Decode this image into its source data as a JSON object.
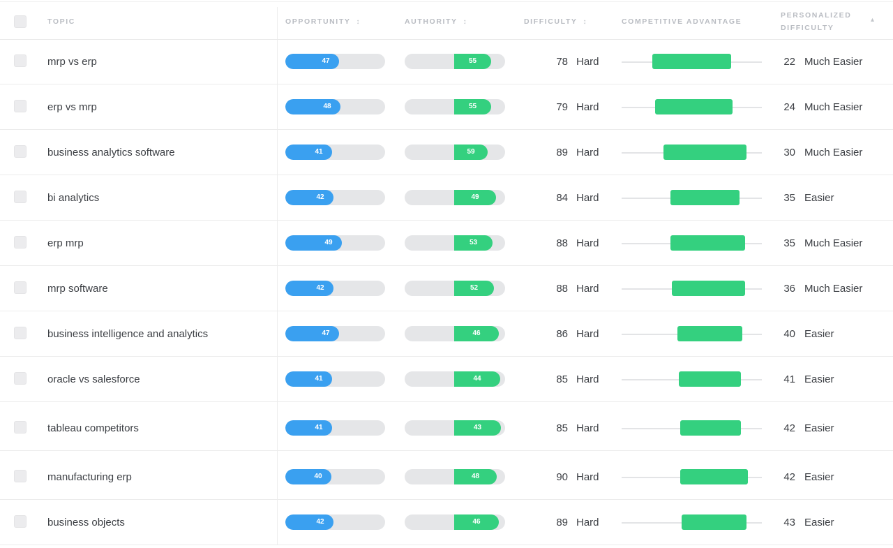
{
  "header": {
    "topic": "TOPIC",
    "opportunity": "OPPORTUNITY",
    "authority": "AUTHORITY",
    "difficulty": "DIFFICULTY",
    "competitive_advantage": "COMPETITIVE ADVANTAGE",
    "personalized_difficulty": "PERSONALIZED DIFFICULTY",
    "sort_glyph": "↕",
    "sort_active_glyph": "▴"
  },
  "colors": {
    "opportunity": "#3aa0f0",
    "authority": "#34d07f",
    "advantage": "#34d07f"
  },
  "rows": [
    {
      "topic": "mrp vs erp",
      "opportunity": "47",
      "authority": "55",
      "difficulty": "78",
      "difficulty_label": "Hard",
      "advantage": {
        "start": 0.22,
        "end": 0.78
      },
      "personalized": "22",
      "personalized_label": "Much Easier"
    },
    {
      "topic": "erp vs mrp",
      "opportunity": "48",
      "authority": "55",
      "difficulty": "79",
      "difficulty_label": "Hard",
      "advantage": {
        "start": 0.24,
        "end": 0.79
      },
      "personalized": "24",
      "personalized_label": "Much Easier"
    },
    {
      "topic": "business analytics software",
      "opportunity": "41",
      "authority": "59",
      "difficulty": "89",
      "difficulty_label": "Hard",
      "advantage": {
        "start": 0.3,
        "end": 0.89
      },
      "personalized": "30",
      "personalized_label": "Much Easier"
    },
    {
      "topic": "bi analytics",
      "opportunity": "42",
      "authority": "49",
      "difficulty": "84",
      "difficulty_label": "Hard",
      "advantage": {
        "start": 0.35,
        "end": 0.84
      },
      "personalized": "35",
      "personalized_label": "Easier"
    },
    {
      "topic": "erp mrp",
      "opportunity": "49",
      "authority": "53",
      "difficulty": "88",
      "difficulty_label": "Hard",
      "advantage": {
        "start": 0.35,
        "end": 0.88
      },
      "personalized": "35",
      "personalized_label": "Much Easier"
    },
    {
      "topic": "mrp software",
      "opportunity": "42",
      "authority": "52",
      "difficulty": "88",
      "difficulty_label": "Hard",
      "advantage": {
        "start": 0.36,
        "end": 0.88
      },
      "personalized": "36",
      "personalized_label": "Much Easier"
    },
    {
      "topic": "business intelligence and analytics",
      "opportunity": "47",
      "authority": "46",
      "difficulty": "86",
      "difficulty_label": "Hard",
      "advantage": {
        "start": 0.4,
        "end": 0.86
      },
      "personalized": "40",
      "personalized_label": "Easier"
    },
    {
      "topic": "oracle vs salesforce",
      "opportunity": "41",
      "authority": "44",
      "difficulty": "85",
      "difficulty_label": "Hard",
      "advantage": {
        "start": 0.41,
        "end": 0.85
      },
      "personalized": "41",
      "personalized_label": "Easier"
    },
    {
      "topic": "tableau competitors",
      "opportunity": "41",
      "authority": "43",
      "difficulty": "85",
      "difficulty_label": "Hard",
      "advantage": {
        "start": 0.42,
        "end": 0.85
      },
      "personalized": "42",
      "personalized_label": "Easier"
    },
    {
      "topic": "manufacturing erp",
      "opportunity": "40",
      "authority": "48",
      "difficulty": "90",
      "difficulty_label": "Hard",
      "advantage": {
        "start": 0.42,
        "end": 0.9
      },
      "personalized": "42",
      "personalized_label": "Easier"
    },
    {
      "topic": "business objects",
      "opportunity": "42",
      "authority": "46",
      "difficulty": "89",
      "difficulty_label": "Hard",
      "advantage": {
        "start": 0.43,
        "end": 0.89
      },
      "personalized": "43",
      "personalized_label": "Easier"
    }
  ]
}
